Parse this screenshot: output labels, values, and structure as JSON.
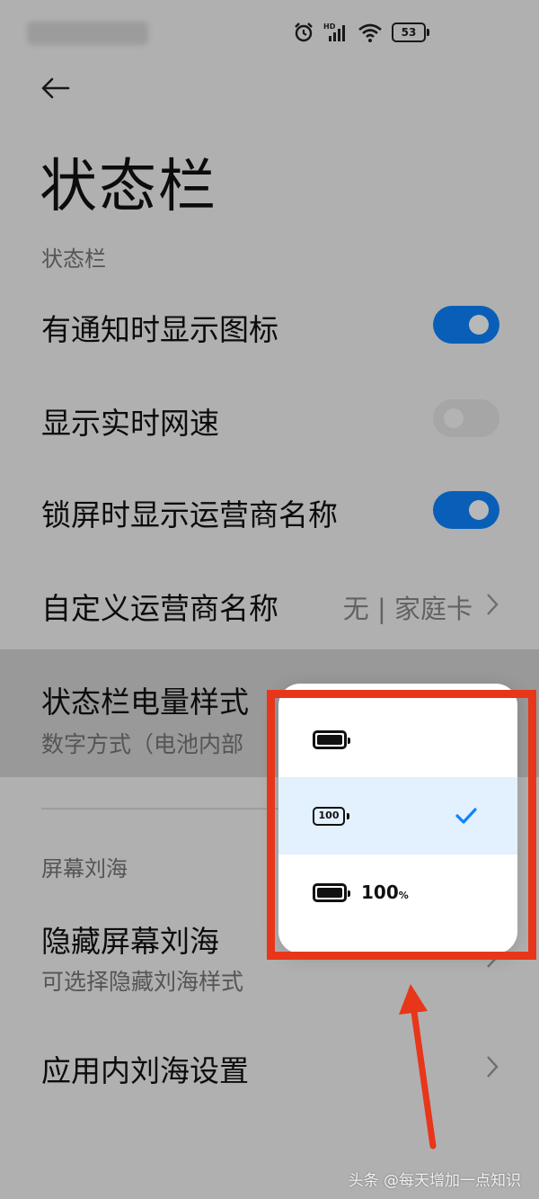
{
  "page": {
    "title": "状态栏"
  },
  "status_bar": {
    "battery_level": "53",
    "icons": [
      "alarm-icon",
      "hd-signal-icon",
      "wifi-icon",
      "battery-icon"
    ]
  },
  "sections": {
    "status_bar_header": "状态栏",
    "notch_header": "屏幕刘海"
  },
  "rows": {
    "notify_icons": {
      "label": "有通知时显示图标",
      "toggle": "on"
    },
    "realtime_speed": {
      "label": "显示实时网速",
      "toggle": "off"
    },
    "lockscreen_carrier": {
      "label": "锁屏时显示运营商名称",
      "toggle": "on"
    },
    "custom_carrier": {
      "label": "自定义运营商名称",
      "value": "无 | 家庭卡"
    },
    "battery_style": {
      "label": "状态栏电量样式",
      "sub": "数字方式（电池内部"
    },
    "hide_notch": {
      "label": "隐藏屏幕刘海",
      "sub": "可选择隐藏刘海样式"
    },
    "app_notch": {
      "label": "应用内刘海设置"
    }
  },
  "battery_popup": {
    "options": [
      {
        "icon": "battery-full-icon",
        "text": "",
        "selected": false
      },
      {
        "icon": "battery-number-icon",
        "text": "100",
        "selected": true
      },
      {
        "icon": "battery-full-icon",
        "text": "100",
        "unit": "%",
        "selected": false
      }
    ]
  },
  "colors": {
    "accent": "#0d84ff",
    "annotation": "#e8361b"
  },
  "watermark": "头条 @每天增加一点知识"
}
